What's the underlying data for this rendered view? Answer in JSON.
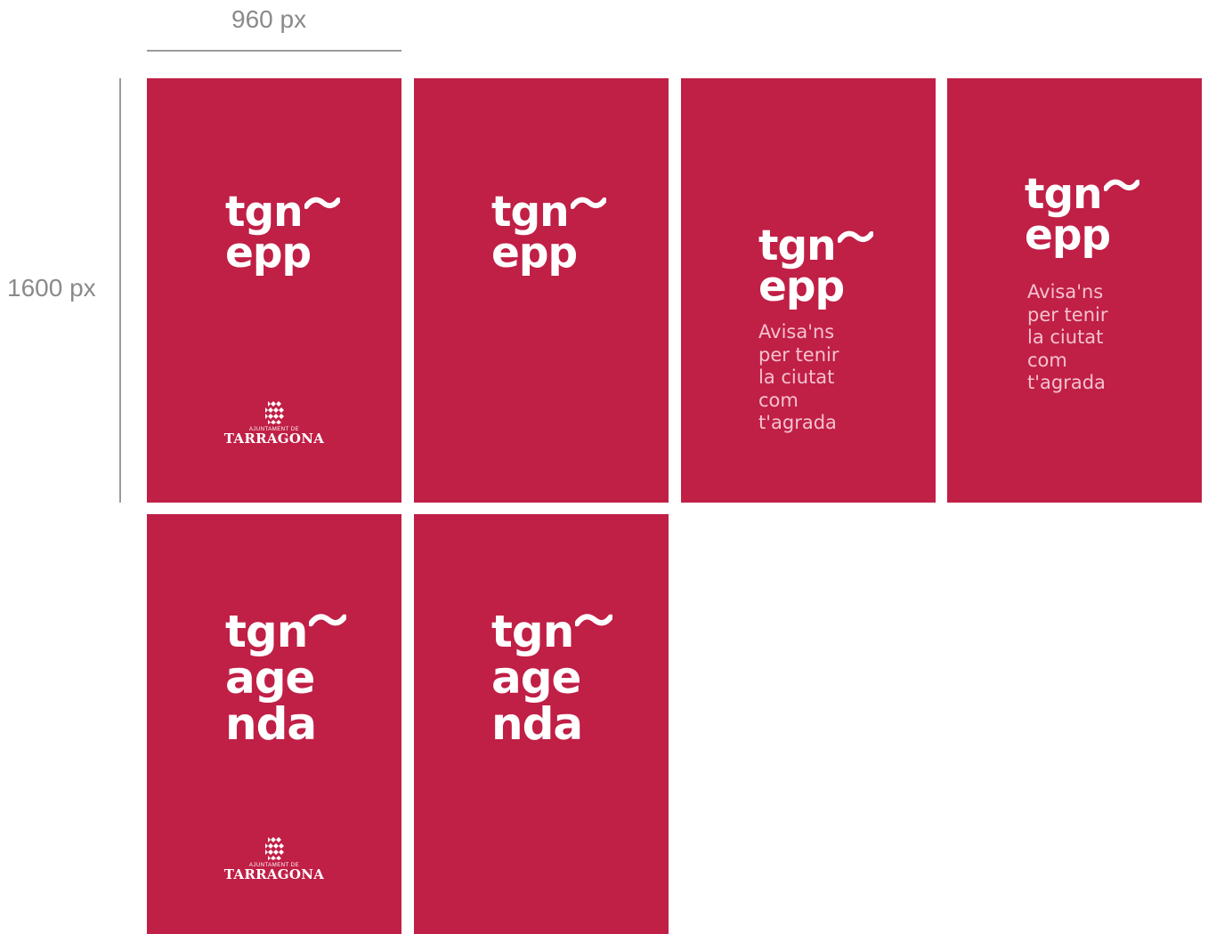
{
  "dimensions": {
    "width_label": "960 px",
    "height_label": "1600 px"
  },
  "brand_color": "#c01f46",
  "logo_epp": {
    "line1": "tgn",
    "line2": "epp"
  },
  "logo_agenda": {
    "line1": "tgn",
    "line2": "age",
    "line3": "nda"
  },
  "tagline": "Avisa'ns\nper tenir\nla ciutat\ncom\nt'agrada",
  "crest": {
    "subtitle": "AJUNTAMENT DE",
    "name": "TARRAGONA",
    "icon": "tarragona-crest-icon"
  }
}
